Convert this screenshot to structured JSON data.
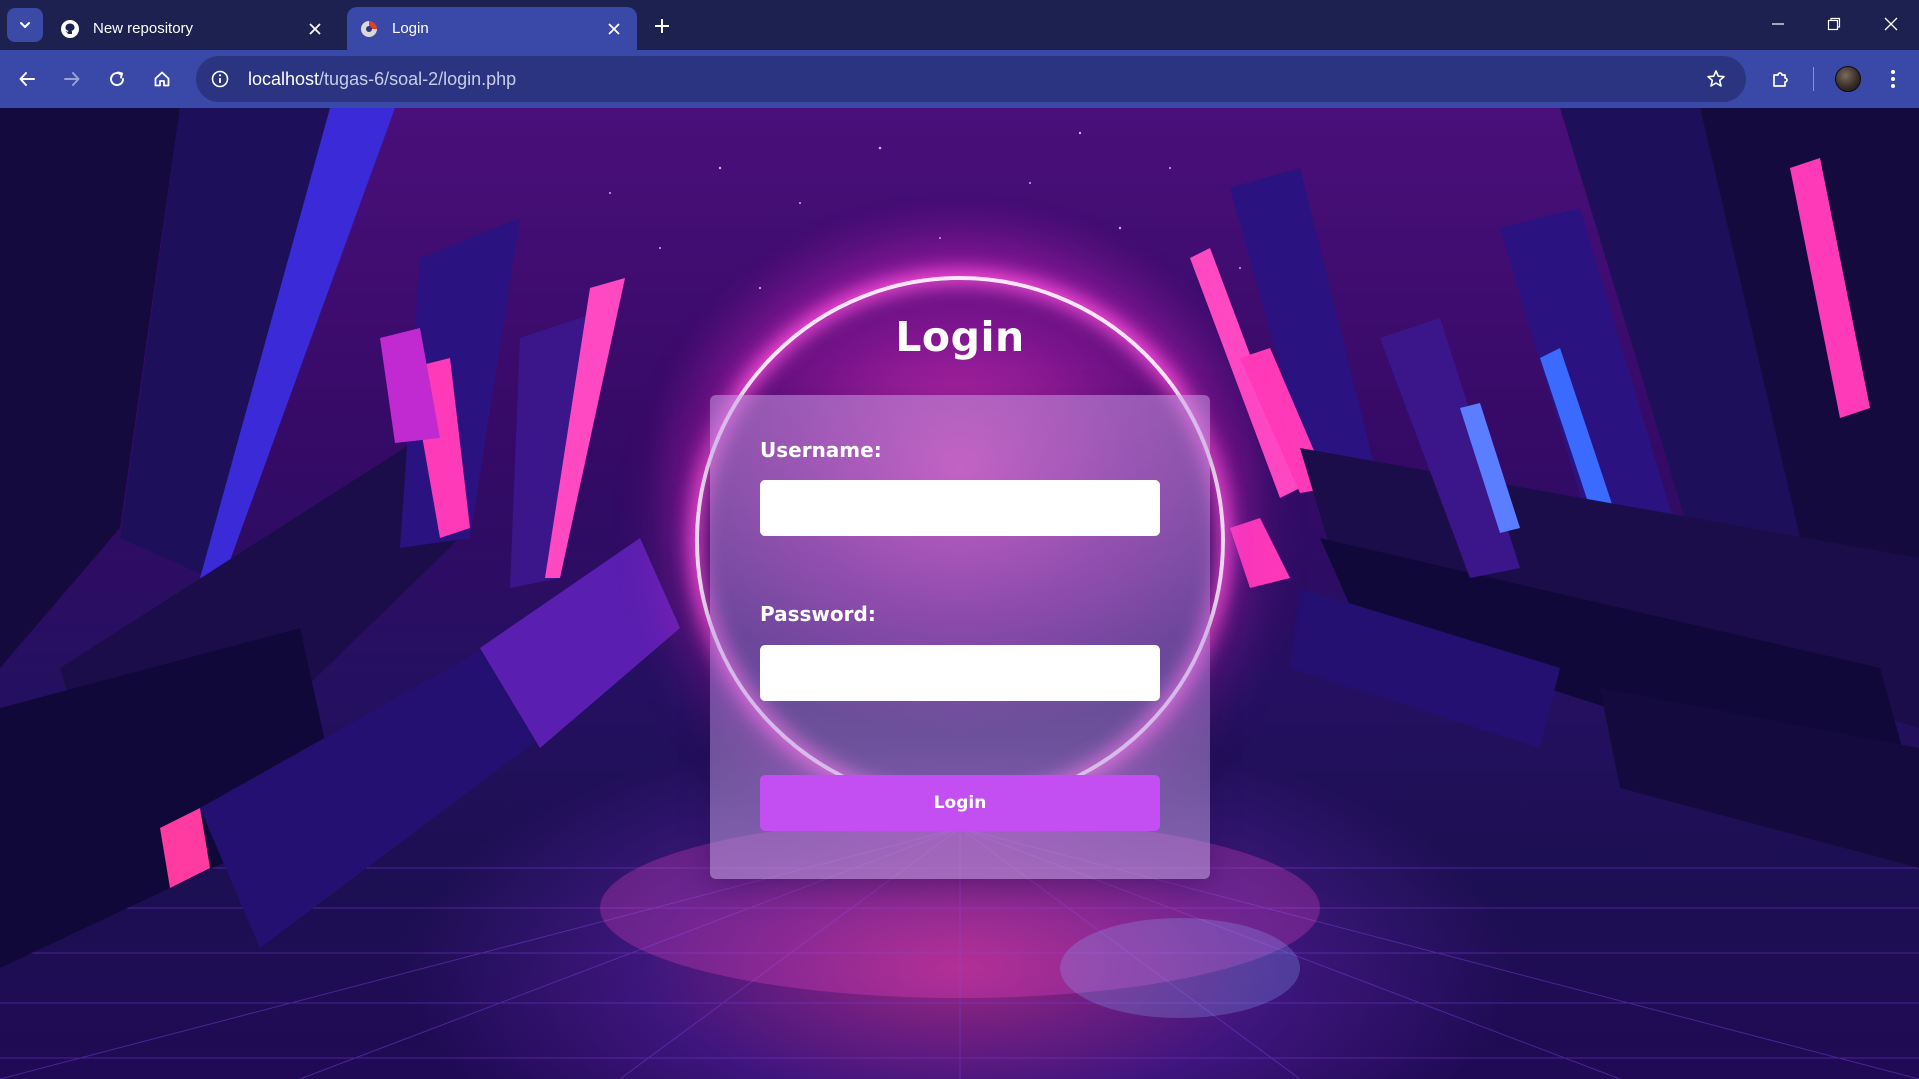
{
  "browser": {
    "tabs": [
      {
        "title": "New repository",
        "favicon": "github-icon",
        "active": false
      },
      {
        "title": "Login",
        "favicon": "page-favicon-icon",
        "active": true
      }
    ],
    "url": {
      "host": "localhost",
      "path": "/tugas-6/soal-2/login.php"
    },
    "colors": {
      "tabbar": "#1c2150",
      "toolbar": "#3a48a8",
      "omnibox": "#2a3480"
    }
  },
  "login": {
    "title": "Login",
    "username_label": "Username:",
    "username_value": "",
    "password_label": "Password:",
    "password_value": "",
    "submit_label": "Login",
    "colors": {
      "button": "#c34ff2",
      "ring_glow": "#ff50dc"
    }
  }
}
